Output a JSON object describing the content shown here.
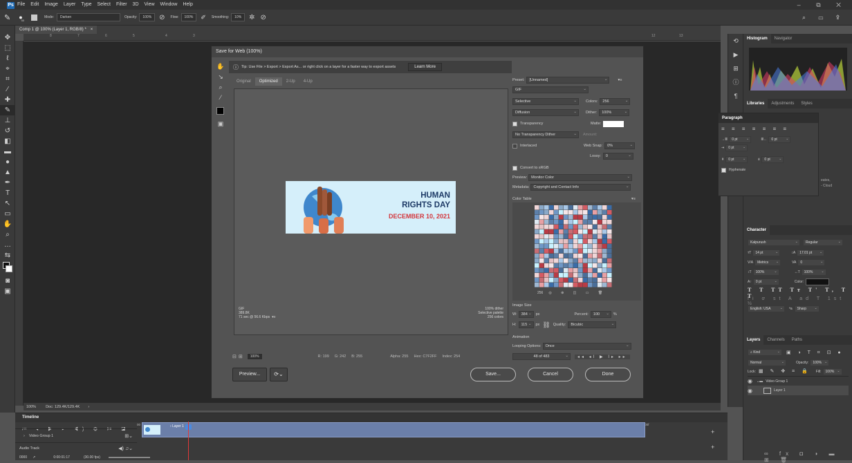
{
  "menubar": {
    "app_icon": "Ps",
    "items": [
      "File",
      "Edit",
      "Image",
      "Layer",
      "Type",
      "Select",
      "Filter",
      "3D",
      "View",
      "Window",
      "Help"
    ],
    "window_controls": [
      "–",
      "⧉",
      "✕"
    ]
  },
  "options": {
    "brush_size": "50",
    "mode_label": "Mode:",
    "mode_value": "Darken",
    "opacity_label": "Opacity:",
    "opacity_value": "100%",
    "flow_label": "Flow:",
    "flow_value": "100%",
    "smoothing_label": "Smoothing:",
    "smoothing_value": "10%"
  },
  "document": {
    "tab_title": "Comp 1 @ 100% (Layer 1, RGB/8) *",
    "close": "×",
    "ruler_marks": [
      "8",
      "7",
      "6",
      "5",
      "4",
      "3",
      "12",
      "13"
    ],
    "zoom": "100%",
    "doc_size": "Doc: 129.4K/129.4K"
  },
  "dialog": {
    "title": "Save for Web (100%)",
    "tip": "Tip: Use File > Export > Export As... or right click on a layer for a faster way to export assets",
    "learn_more": "Learn More",
    "view_tabs": [
      "Original",
      "Optimized",
      "2-Up",
      "4-Up"
    ],
    "active_view_tab": "Optimized",
    "banner": {
      "title_line1": "HUMAN",
      "title_line2": "RIGHTS DAY",
      "date": "DECEMBER 10, 2021"
    },
    "preview_info_left": [
      "GIF",
      "389.8K",
      "71 sec @ 56.6 Kbps"
    ],
    "preview_info_right": [
      "100% dither",
      "Selective palette",
      "256 colors"
    ],
    "status": {
      "zoom": "100%",
      "r": "R: 199",
      "g": "G: 242",
      "b": "B: 255",
      "alpha": "Alpha: 255",
      "hex": "Hex: C7F2FF",
      "index": "Index: 254"
    },
    "buttons": {
      "preview": "Preview...",
      "save": "Save...",
      "cancel": "Cancel",
      "done": "Done"
    },
    "settings": {
      "preset_label": "Preset:",
      "preset_value": "[Unnamed]",
      "format": "GIF",
      "reduction": "Selective",
      "colors_label": "Colors:",
      "colors_value": "256",
      "dither_algo": "Diffusion",
      "dither_label": "Dither:",
      "dither_value": "100%",
      "transparency": "Transparency",
      "matte_label": "Matte:",
      "trans_dither": "No Transparency Dither",
      "amount_label": "Amount:",
      "interlaced": "Interlaced",
      "websnap_label": "Web Snap:",
      "websnap_value": "0%",
      "lossy_label": "Lossy:",
      "lossy_value": "0",
      "convert_srgb": "Convert to sRGB",
      "preview_label": "Preview:",
      "preview_value": "Monitor Color",
      "metadata_label": "Metadata:",
      "metadata_value": "Copyright and Contact Info",
      "color_table_label": "Color Table",
      "color_count": "256",
      "image_size_label": "Image Size",
      "w_label": "W:",
      "w_value": "384",
      "h_label": "H:",
      "h_value": "115",
      "px": "px",
      "percent_label": "Percent:",
      "percent_value": "100",
      "percent_unit": "%",
      "quality_label": "Quality:",
      "quality_value": "Bicubic",
      "animation_label": "Animation",
      "looping_label": "Looping Options:",
      "looping_value": "Once",
      "frame_counter": "48 of 483"
    }
  },
  "panels": {
    "histogram_tabs": [
      "Histogram",
      "Navigator"
    ],
    "library_tabs": [
      "Libraries",
      "Adjustments",
      "Styles"
    ],
    "paragraph_title": "Paragraph",
    "paragraph_fields": [
      "0 pt",
      "0 pt",
      "0 pt",
      "0 pt",
      "0 pt"
    ],
    "hyphenate": "Hyphenate",
    "cloud_fragments": [
      "eates,",
      "- Cloud"
    ],
    "character_title": "Character",
    "font_family": "Kalpurush",
    "font_style": "Regular",
    "font_size": "14 pt",
    "leading": "17.01 pt",
    "kerning": "Metrics",
    "tracking": "0",
    "vscale": "100%",
    "hscale": "100%",
    "baseline": "0 pt",
    "color_label": "Color:",
    "language": "English: USA",
    "aa_label": "ªa",
    "aa_value": "Sharp",
    "layers_tabs": [
      "Layers",
      "Channels",
      "Paths"
    ],
    "kind": "Kind",
    "blend": "Normal",
    "opacity_label": "Opacity:",
    "opacity_value": "100%",
    "lock_label": "Lock:",
    "fill_label": "Fill:",
    "fill_value": "100%",
    "layers": [
      "Video Group 1",
      "Layer 1"
    ]
  },
  "timeline": {
    "title": "Timeline",
    "ticks": [
      "00",
      "01:00f",
      "02:00f",
      "03:00f",
      "04:00f",
      "05:00f",
      "06:00f",
      "07:00f",
      "08:00f",
      "09:00f",
      "10:00f",
      "11:00f",
      "12:00f",
      "13:00f",
      "14:00f",
      "15:00f",
      "16:00f"
    ],
    "tracks": [
      "Video Group 1",
      "Audio Track"
    ],
    "clip_label": "Layer 1",
    "current_time": "0:00:01:17",
    "fps": "(30.00 fps)",
    "frame": "0000"
  }
}
